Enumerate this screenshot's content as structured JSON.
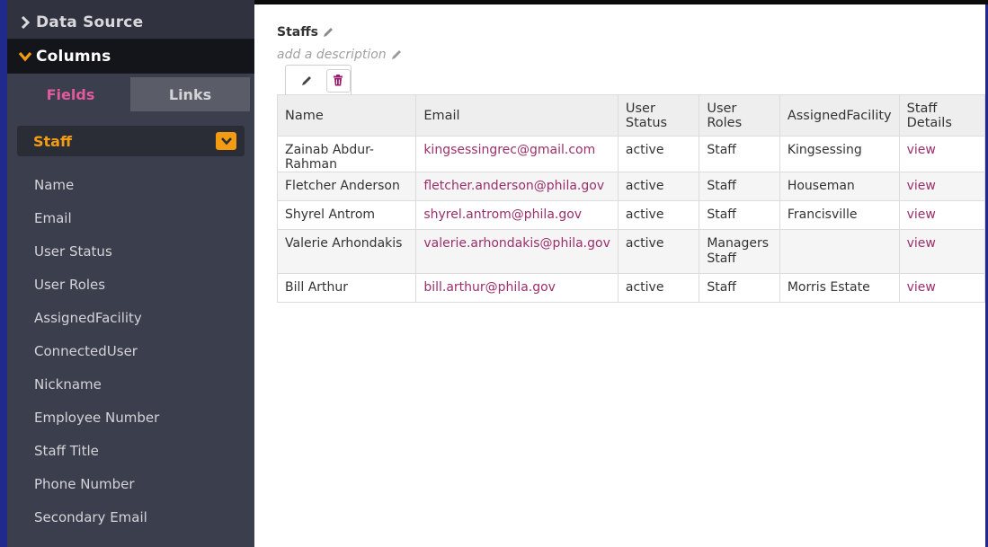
{
  "sidebar": {
    "data_source_label": "Data Source",
    "columns_label": "Columns",
    "tabs": [
      {
        "label": "Fields",
        "active": true
      },
      {
        "label": "Links",
        "active": false
      }
    ],
    "object_select": {
      "value": "Staff"
    },
    "fields": [
      "Name",
      "Email",
      "User Status",
      "User Roles",
      "AssignedFacility",
      "ConnectedUser",
      "Nickname",
      "Employee Number",
      "Staff Title",
      "Phone Number",
      "Secondary Email"
    ]
  },
  "main": {
    "title": "Staffs",
    "description_placeholder": "add a description",
    "table": {
      "columns": [
        "Name",
        "Email",
        "User Status",
        "User Roles",
        "AssignedFacility",
        "Staff Details"
      ],
      "rows": [
        {
          "name": "Zainab Abdur-Rahman",
          "email": "kingsessingrec@gmail.com",
          "status": "active",
          "roles": [
            "Staff"
          ],
          "facility": "Kingsessing",
          "details": "view"
        },
        {
          "name": "Fletcher Anderson",
          "email": "fletcher.anderson@phila.gov",
          "status": "active",
          "roles": [
            "Staff"
          ],
          "facility": "Houseman",
          "details": "view"
        },
        {
          "name": "Shyrel Antrom",
          "email": "shyrel.antrom@phila.gov",
          "status": "active",
          "roles": [
            "Staff"
          ],
          "facility": "Francisville",
          "details": "view"
        },
        {
          "name": "Valerie Arhondakis",
          "email": "valerie.arhondakis@phila.gov",
          "status": "active",
          "roles": [
            "Managers",
            "Staff"
          ],
          "facility": "",
          "details": "view"
        },
        {
          "name": "Bill Arthur",
          "email": "bill.arthur@phila.gov",
          "status": "active",
          "roles": [
            "Staff"
          ],
          "facility": "Morris Estate",
          "details": "view"
        }
      ]
    }
  },
  "colors": {
    "accent_orange": "#f39c12",
    "tab_active_pink": "#e05a9d",
    "link_color": "#9b2f6b",
    "sidebar_bg": "#3b3e4c"
  },
  "icons": {
    "data_source_chevron": "chevron-right-icon",
    "columns_chevron": "chevron-down-icon",
    "select_caret": "chevron-down-icon",
    "edit": "pencil-icon",
    "delete": "trash-icon"
  }
}
